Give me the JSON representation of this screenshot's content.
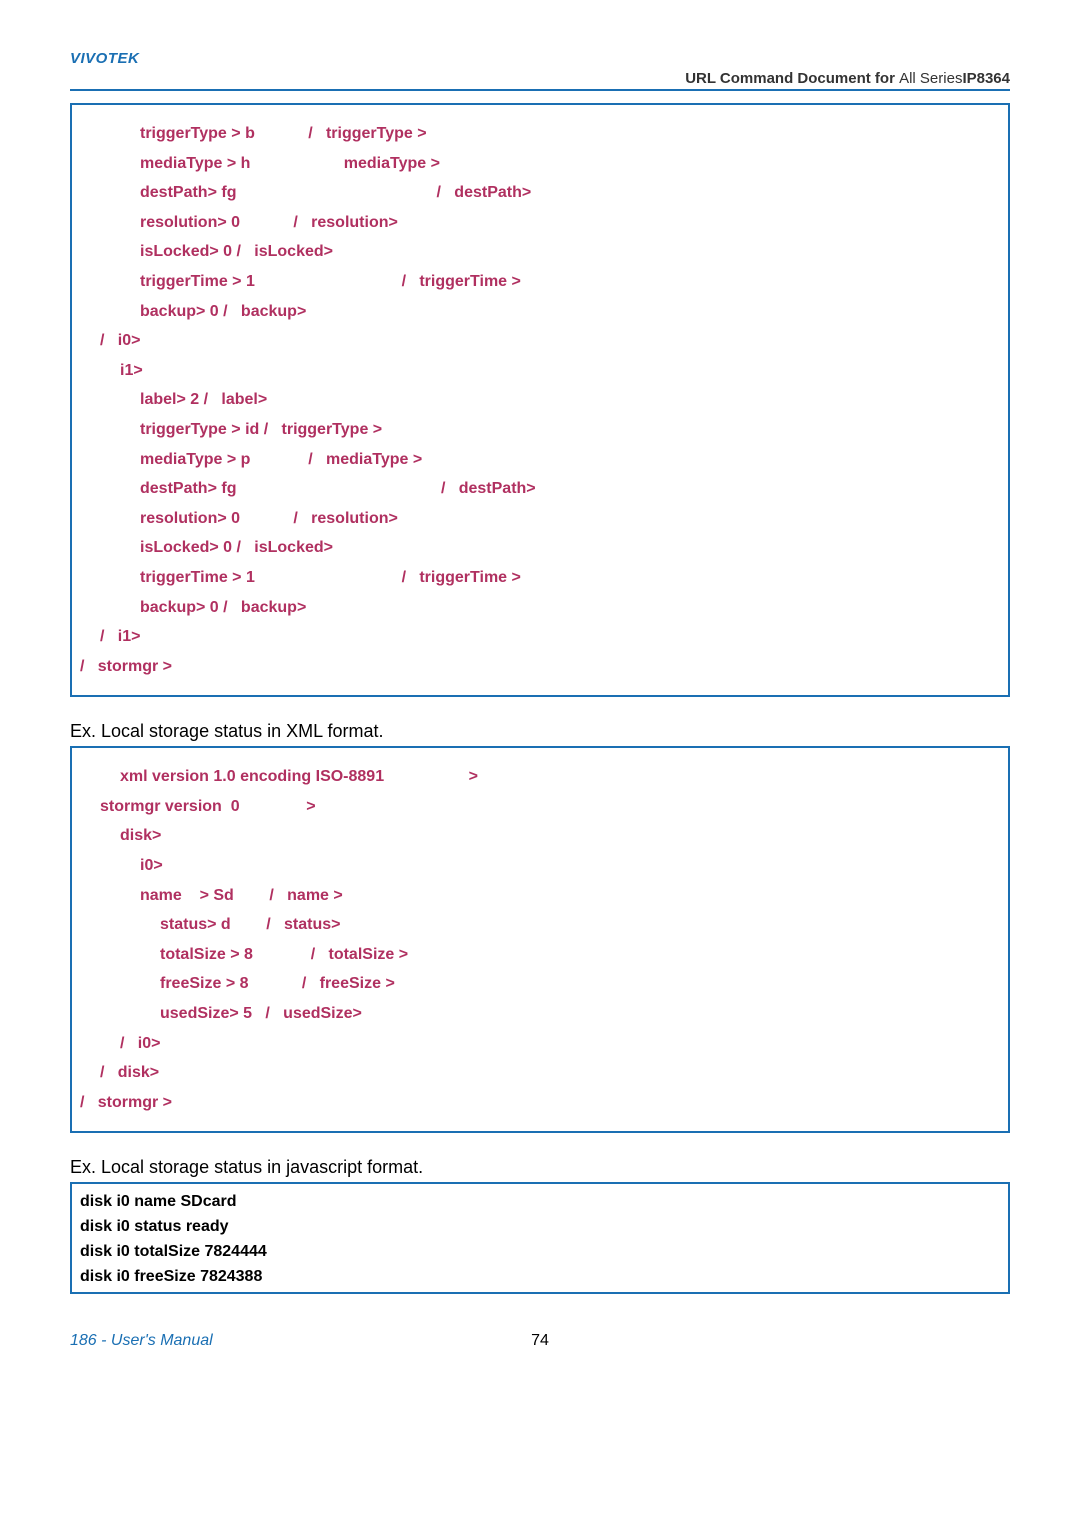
{
  "header": {
    "brand": "VIVOTEK",
    "title_left": "URL Command Document for ",
    "title_mid": "All Series",
    "title_right": "IP8364"
  },
  "block1": {
    "lines": [
      " <            triggerType > b            /   triggerType >",
      " <            mediaType > h                     mediaType >",
      " <            destPath> fg                                             /   destPath>",
      " <            resolution> 0            /   resolution>",
      " <            isLocked> 0 /   isLocked>",
      " <            triggerTime > 1                                 /   triggerTime >",
      " <            backup> 0 /   backup>",
      " <    /   i0>",
      " <       i1>",
      " <          label> 2 /   label>",
      " <          triggerType > id /   triggerType >",
      " <          mediaType > p             /   mediaType >",
      " <          destPath> fg                                              /   destPath>",
      " <          resolution> 0            /   resolution>",
      " <          isLocked> 0 /   isLocked>",
      " <          triggerTime > 1                                 /   triggerTime >",
      " <          backup> 0 /   backup>",
      " <   /   i1>",
      "</   stormgr >"
    ]
  },
  "para1": "Ex. Local storage status in XML format.",
  "block2": {
    "lines": [
      "<?     xml version 1.0 encoding ISO-8891                  ?>",
      " <  stormgr version  0               >",
      " <     disk>",
      " <        i0>",
      " <       name    > Sd        /   name >",
      " <           status> d        /   status>",
      " <           totalSize > 8             /   totalSize >",
      " <           freeSize > 8            /   freeSize >",
      " <           usedSize> 5   /   usedSize>",
      " <    /   i0>",
      " <  /   disk>",
      "</   stormgr >"
    ]
  },
  "para2": "Ex. Local storage status in javascript format.",
  "block3": {
    "lines": [
      "disk i0 name SDcard",
      "disk i0 status ready",
      "disk i0 totalSize 7824444",
      "disk i0 freeSize 7824388"
    ]
  },
  "footer": {
    "left": "186 - User's Manual",
    "center": "74"
  }
}
